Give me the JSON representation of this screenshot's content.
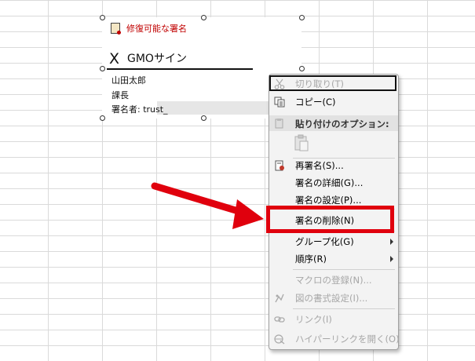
{
  "signature": {
    "badge_text": "修復可能な署名",
    "x_mark": "X",
    "signer_display_name": "GMOサイン",
    "name_line": "山田太郎",
    "title_line": "課長",
    "signer_line": "署名者: trust_"
  },
  "context_menu": {
    "items": [
      {
        "label": "切り取り(T)",
        "icon": "scissors-icon",
        "enabled": false
      },
      {
        "label": "コピー(C)",
        "icon": "copy-icon",
        "enabled": true
      },
      {
        "label": "貼り付けのオプション:",
        "icon": "paste-icon",
        "enabled": true
      },
      {
        "label": "再署名(S)...",
        "icon": "resign-icon",
        "enabled": true
      },
      {
        "label": "署名の詳細(G)...",
        "enabled": true
      },
      {
        "label": "署名の設定(P)...",
        "enabled": true
      },
      {
        "label": "署名の削除(N)",
        "enabled": true
      },
      {
        "label": "グループ化(G)",
        "enabled": true,
        "submenu": true
      },
      {
        "label": "順序(R)",
        "enabled": true,
        "submenu": true
      },
      {
        "label": "マクロの登録(N)...",
        "enabled": false
      },
      {
        "label": "図の書式設定(I)...",
        "icon": "format-picture-icon",
        "enabled": false
      },
      {
        "label": "リンク(I)",
        "icon": "link-icon",
        "enabled": false
      },
      {
        "label": "ハイパーリンクを開く(O)",
        "icon": "open-hyperlink-icon",
        "enabled": false
      }
    ]
  },
  "annotation": {
    "highlight_color": "#e0000d",
    "highlighted_item": "署名の削除(N)"
  }
}
